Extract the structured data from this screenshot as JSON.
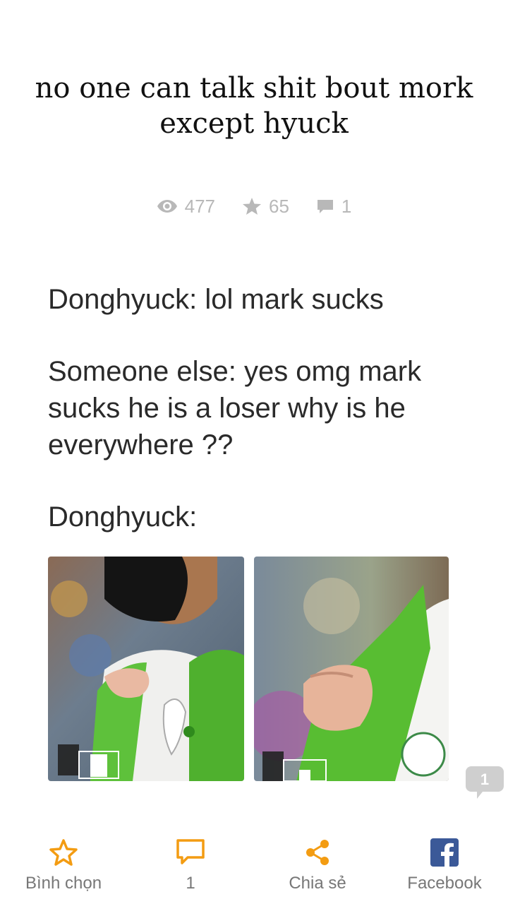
{
  "story": {
    "title": "no one can talk shit bout mork except hyuck"
  },
  "stats": {
    "views": "477",
    "votes": "65",
    "comments": "1"
  },
  "meme": {
    "line1": "Donghyuck: lol mark sucks",
    "line2": "Someone else: yes omg mark sucks he is a loser why is he everywhere ??",
    "line3": "Donghyuck:"
  },
  "floating_comment": {
    "count": "1"
  },
  "bottom_bar": {
    "vote_label": "Bình chọn",
    "comment_label": "1",
    "share_label": "Chia sẻ",
    "facebook_label": "Facebook"
  },
  "colors": {
    "accent": "#f39c12",
    "muted": "#b8b8b8",
    "facebook": "#3b5998"
  }
}
